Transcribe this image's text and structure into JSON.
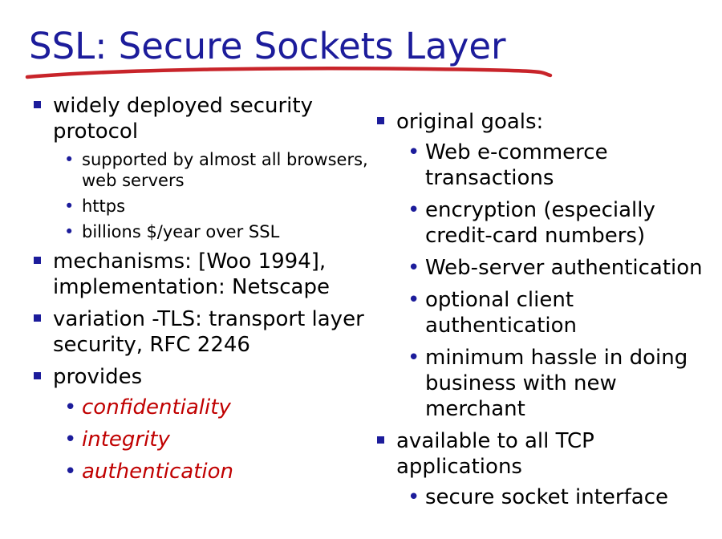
{
  "title": "SSL: Secure Sockets Layer",
  "colors": {
    "title": "#1c1c9b",
    "underline": "#c8242a",
    "bullet": "#1c1c9b",
    "emphasis": "#c00000"
  },
  "left": {
    "items": [
      {
        "text": "widely deployed security protocol",
        "subitems": [
          "supported by almost all browsers, web servers",
          "https",
          "billions $/year over SSL"
        ]
      },
      {
        "text": "mechanisms: [Woo 1994], implementation: Netscape"
      },
      {
        "text": "variation -TLS: transport layer security, RFC 2246"
      },
      {
        "text": "provides",
        "subitems": [
          "confidentiality",
          "integrity",
          "authentication"
        ]
      }
    ]
  },
  "right": {
    "items": [
      {
        "text": "original goals:",
        "subitems": [
          "Web e-commerce transactions",
          "encryption (especially credit-card numbers)",
          "Web-server authentication",
          "optional client authentication",
          "minimum hassle in doing business with new merchant"
        ]
      },
      {
        "text": "available to all TCP applications",
        "subitems": [
          "secure socket interface"
        ]
      }
    ]
  }
}
